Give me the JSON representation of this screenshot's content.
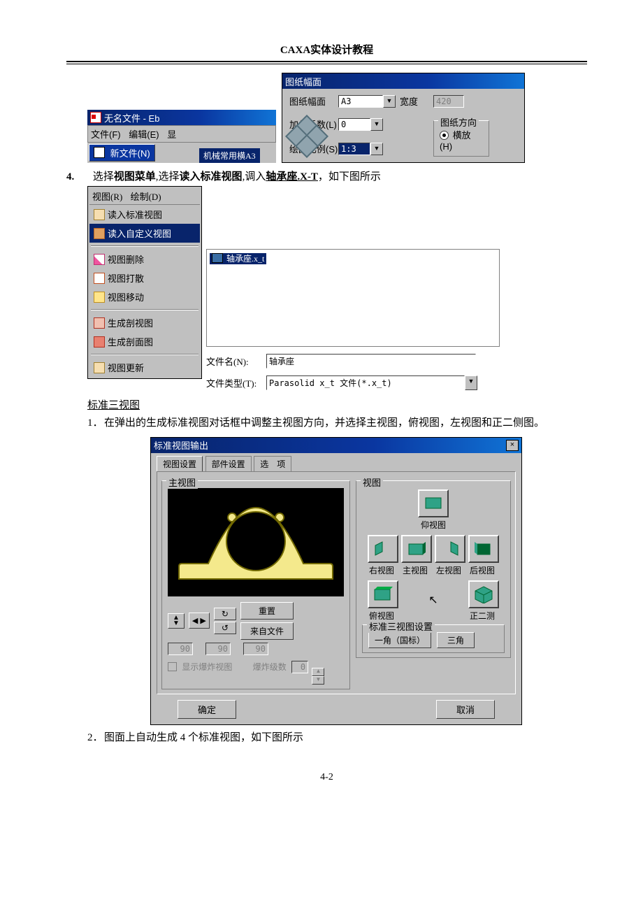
{
  "header": {
    "title": "CAXA实体设计教程"
  },
  "page_footer": "4-2",
  "top_left_window": {
    "title": "无名文件 - Eb",
    "menu": {
      "file": "文件(F)",
      "edit": "编辑(E)",
      "disp": "显"
    },
    "newfile_btn": "新文件(N)",
    "template": "机械常用横A3"
  },
  "top_right_panel": {
    "heading": "图纸幅面",
    "rows": {
      "size_label": "图纸幅面",
      "size_value": "A3",
      "width_label": "宽度",
      "width_value": "420",
      "mult_label": "加长系数(L)",
      "mult_value": "0",
      "orient_group": "图纸方向",
      "orient_value": "横放(H)",
      "scale_label": "绘图比例(S)",
      "scale_value": "1:3"
    }
  },
  "step4": {
    "num": "4.",
    "pre": "选择",
    "a": "视图菜单",
    "mid1": ",选择",
    "b": "读入标准视图",
    "mid2": ",调入",
    "c": "轴承座.X-T",
    "tail": "，如下图所示"
  },
  "view_menu": {
    "head": {
      "view": "视图(R)",
      "draw": "绘制(D)"
    },
    "items": {
      "read_std": "读入标准视图",
      "read_custom": "读入自定义视图",
      "delete": "视图删除",
      "explode": "视图打散",
      "move": "视图移动",
      "section_view": "生成剖视图",
      "section_face": "生成剖面图",
      "update": "视图更新"
    }
  },
  "file_picker": {
    "file_item": "轴承座.x_t",
    "name_label": "文件名(N):",
    "name_value": "轴承座",
    "type_label": "文件类型(T):",
    "type_value": "Parasolid x_t 文件(*.x_t)"
  },
  "section_h1": "标准三视图",
  "step_1": {
    "num": "1．",
    "text": "在弹出的生成标准视图对话框中调整主视图方向，并选择主视图，俯视图，左视图和正二侧图。"
  },
  "dialog": {
    "title": "标准视图输出",
    "tabs": {
      "a": "视图设置",
      "b": "部件设置",
      "c": "选　项"
    },
    "group_main": "主视图",
    "group_views": "视图",
    "labels": {
      "bottom": "仰视图",
      "right": "右视图",
      "front": "主视图",
      "left": "左视图",
      "back": "后视图",
      "top": "俯视图",
      "iso": "正二测"
    },
    "reset": "重置",
    "from_file": "来自文件",
    "angle": "90",
    "show_explode": "显示爆炸视图",
    "explode_lvl_lbl": "爆炸级数",
    "explode_lvl": "0",
    "std_setting_group": "标准三视图设置",
    "angle_mode": "一角（国标）",
    "angle_alt": "三角",
    "ok": "确定",
    "cancel": "取消"
  },
  "step_2": {
    "num": "2．",
    "text": "图面上自动生成 4 个标准视图，如下图所示"
  }
}
